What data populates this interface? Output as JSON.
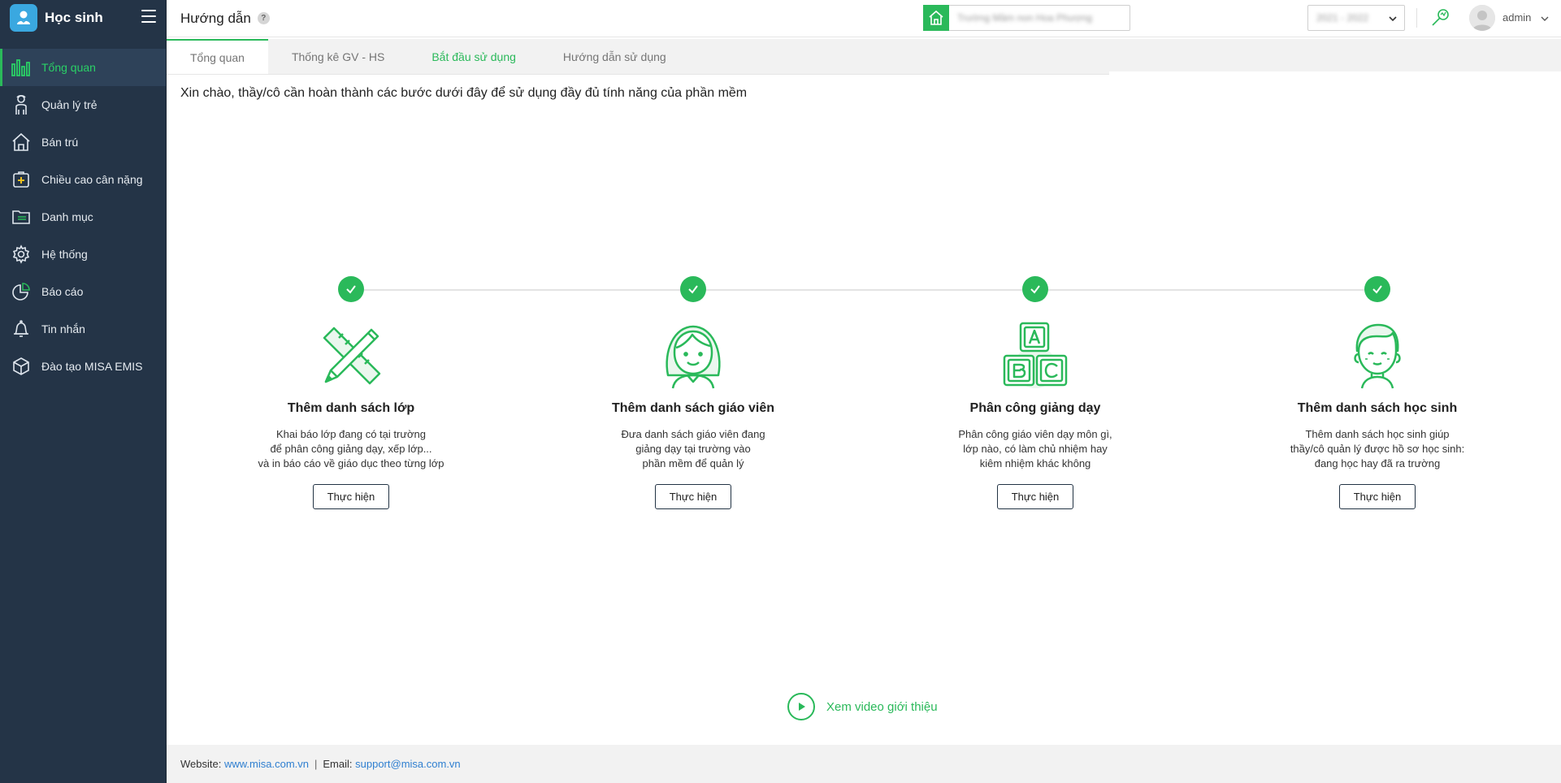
{
  "app": {
    "name": "Học sinh"
  },
  "sidebar": {
    "items": [
      {
        "label": "Tổng quan",
        "icon": "dashboard-bar-icon",
        "active": true
      },
      {
        "label": "Quản lý trẻ",
        "icon": "child-icon"
      },
      {
        "label": "Bán trú",
        "icon": "house-icon"
      },
      {
        "label": "Chiều cao cân nặng",
        "icon": "health-plus-icon"
      },
      {
        "label": "Danh mục",
        "icon": "folder-list-icon"
      },
      {
        "label": "Hệ thống",
        "icon": "gear-icon"
      },
      {
        "label": "Báo cáo",
        "icon": "pie-chart-icon"
      },
      {
        "label": "Tin nhắn",
        "icon": "bell-icon"
      },
      {
        "label": "Đào tạo MISA EMIS",
        "icon": "cube-icon"
      }
    ]
  },
  "header": {
    "title": "Hướng dẫn",
    "help": "?",
    "school_name": "Trường Mầm non Hoa Phượng",
    "school_year": "2021 - 2022",
    "username": "admin"
  },
  "tabs": [
    {
      "label": "Tổng quan",
      "active": true
    },
    {
      "label": "Thống kê GV - HS"
    },
    {
      "label": "Bắt đầu sử dụng",
      "highlight": true
    },
    {
      "label": "Hướng dẫn sử dụng"
    }
  ],
  "greeting": "Xin chào, thầy/cô cần hoàn thành các bước dưới đây để sử dụng đầy đủ tính năng của phần mềm",
  "steps": [
    {
      "title": "Thêm danh sách lớp",
      "description": "Khai báo lớp đang có tại trường\nđể phân công giảng dạy, xếp lớp...\nvà in báo cáo về giáo dục theo từng lớp",
      "button": "Thực hiện",
      "icon": "ruler-pencil-icon",
      "completed": true
    },
    {
      "title": "Thêm danh sách giáo viên",
      "description": "Đưa danh sách giáo viên đang\ngiảng dạy tại trường vào\nphần mềm để quản lý",
      "button": "Thực hiện",
      "icon": "teacher-icon",
      "completed": true
    },
    {
      "title": "Phân công giảng dạy",
      "description": "Phân công giáo viên dạy môn gì,\nlớp nào, có làm chủ nhiệm hay\nkiêm nhiệm khác không",
      "button": "Thực hiện",
      "icon": "abc-blocks-icon",
      "completed": true
    },
    {
      "title": "Thêm danh sách học sinh",
      "description": "Thêm danh sách học sinh giúp\nthầy/cô quản lý được hồ sơ học sinh:\nđang học hay đã ra trường",
      "button": "Thực hiện",
      "icon": "student-icon",
      "completed": true
    }
  ],
  "video_link": "Xem video giới thiệu",
  "footer": {
    "website_label": "Website:",
    "website": "www.misa.com.vn",
    "separator": "|",
    "email_label": "Email:",
    "email": "support@misa.com.vn"
  },
  "colors": {
    "sidebar_bg": "#243447",
    "accent_green": "#2ab95a",
    "link_blue": "#2f7fd0"
  }
}
